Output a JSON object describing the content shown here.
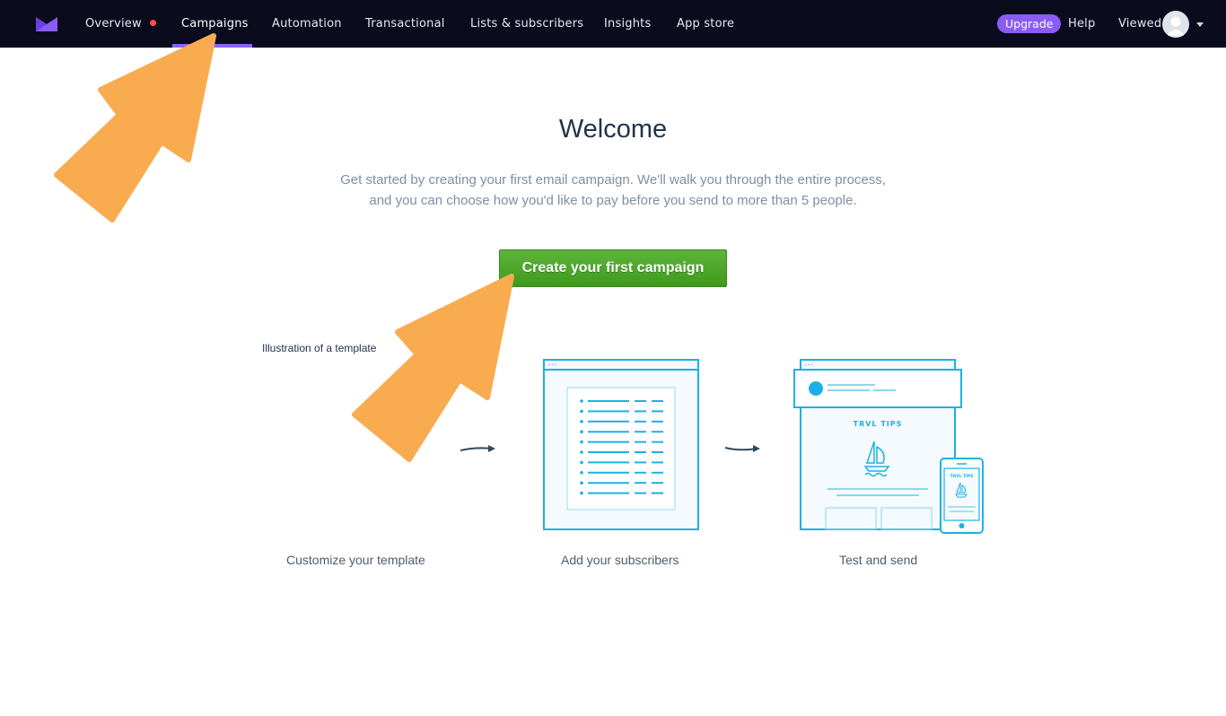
{
  "nav": {
    "items": [
      {
        "label": "Overview",
        "has_notification": true
      },
      {
        "label": "Campaigns",
        "active": true
      },
      {
        "label": "Automation"
      },
      {
        "label": "Transactional"
      },
      {
        "label": "Lists & subscribers"
      },
      {
        "label": "Insights"
      },
      {
        "label": "App store"
      }
    ],
    "upgrade_label": "Upgrade",
    "help_label": "Help",
    "user_label": "Viewed",
    "colors": {
      "bar": "#0a0c1e",
      "accent": "#8a5cf5",
      "notification": "#ff4d4d"
    }
  },
  "main": {
    "title": "Welcome",
    "subtitle_line1": "Get started by creating your first email campaign. We'll walk you through the entire process,",
    "subtitle_line2": "and you can choose how you'd like to pay before you send to more than 5 people.",
    "cta_label": "Create your first campaign",
    "image_alt_text": "Illustration of a template",
    "steps": [
      {
        "label": "Customize your template"
      },
      {
        "label": "Add your subscribers"
      },
      {
        "label": "Test and send"
      }
    ],
    "illustration_text": "TRVL  TIPS",
    "illustration_text_small": "TRVL TIPS"
  },
  "annotations": {
    "arrow_color": "#f9ab4f"
  }
}
